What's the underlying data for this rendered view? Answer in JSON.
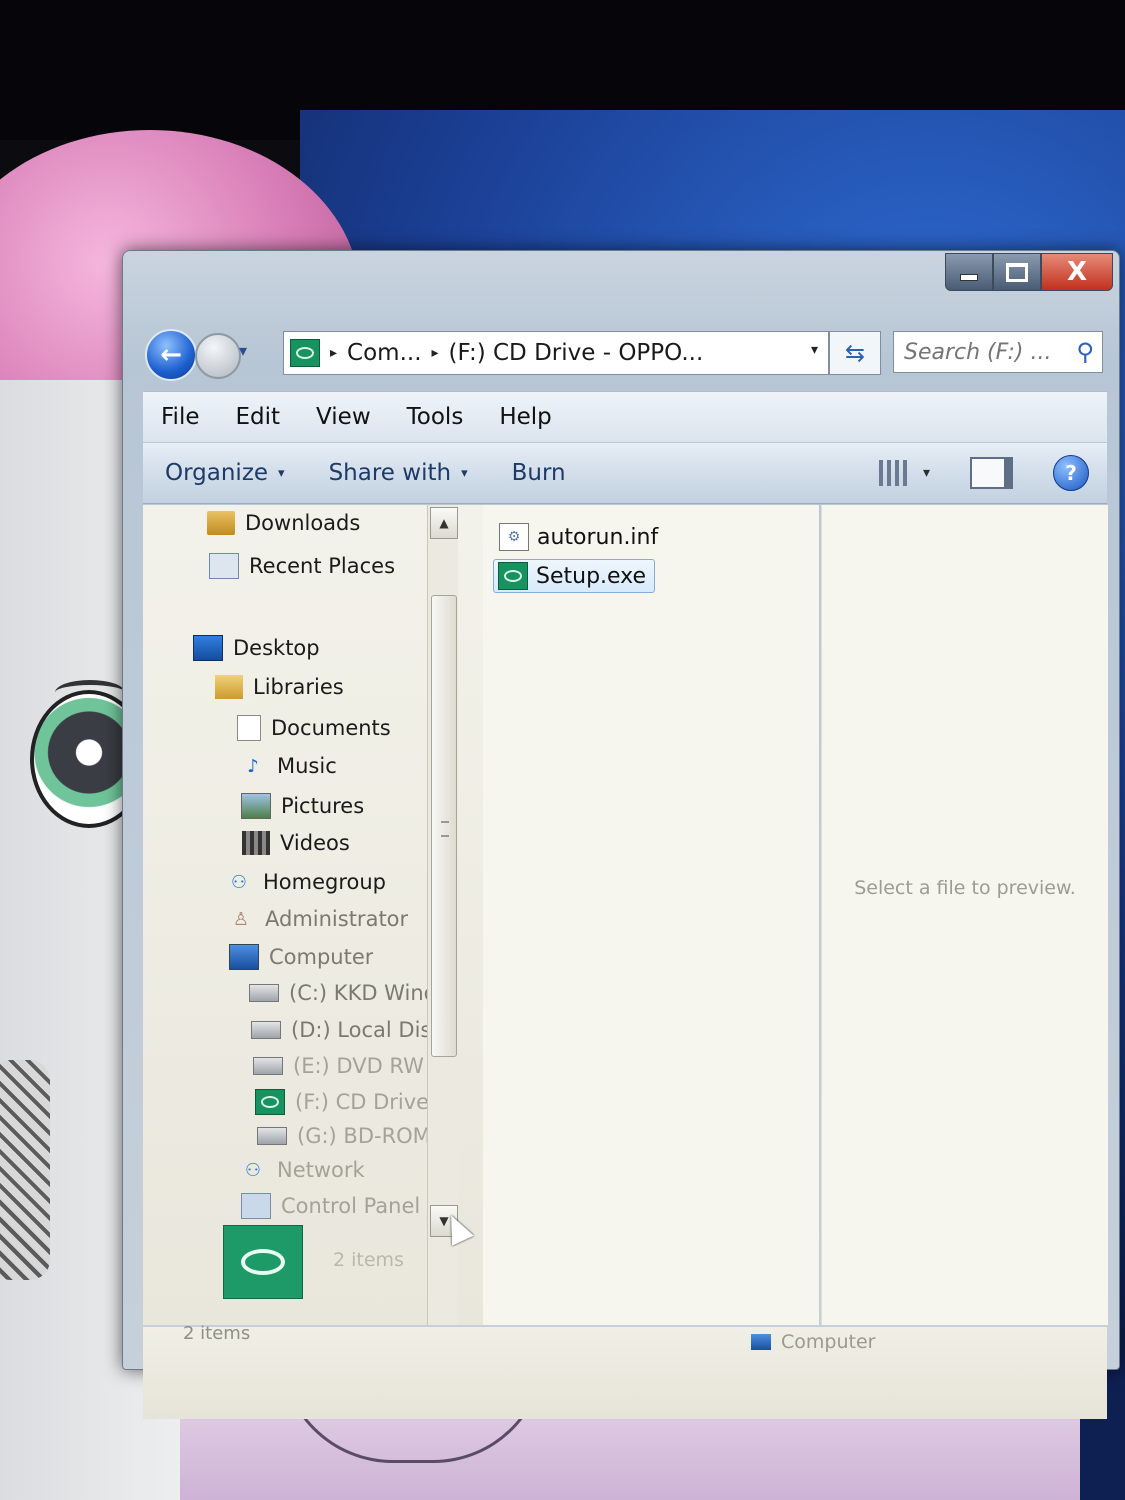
{
  "window": {
    "close_glyph": "X"
  },
  "navigation": {
    "back_glyph": "←",
    "recent_glyph": "▾",
    "breadcrumb": [
      {
        "label": "Com..."
      },
      {
        "label": "(F:) CD Drive - OPPO..."
      }
    ],
    "address_arrow": "▸",
    "address_dropdown_glyph": "▾",
    "refresh_glyph": "⇆",
    "search_placeholder": "Search (F:) ...",
    "search_glyph": "⚲"
  },
  "menubar": {
    "items": [
      "File",
      "Edit",
      "View",
      "Tools",
      "Help"
    ]
  },
  "toolbar": {
    "organize": "Organize",
    "share_with": "Share with",
    "burn": "Burn",
    "caret": "▾",
    "help_glyph": "?"
  },
  "nav_pane": {
    "items": [
      {
        "label": "Downloads",
        "icon": "downloads-icon"
      },
      {
        "label": "Recent Places",
        "icon": "recent-places-icon"
      },
      {
        "label": "Desktop",
        "icon": "desktop-icon"
      },
      {
        "label": "Libraries",
        "icon": "libraries-icon"
      },
      {
        "label": "Documents",
        "icon": "documents-icon"
      },
      {
        "label": "Music",
        "icon": "music-icon",
        "glyph": "♪"
      },
      {
        "label": "Pictures",
        "icon": "pictures-icon"
      },
      {
        "label": "Videos",
        "icon": "videos-icon"
      },
      {
        "label": "Homegroup",
        "icon": "homegroup-icon",
        "glyph": "⚇"
      },
      {
        "label": "Administrator",
        "icon": "user-icon",
        "glyph": "♙"
      },
      {
        "label": "Computer",
        "icon": "computer-icon"
      },
      {
        "label": "(C:) KKD Windc",
        "icon": "drive-icon"
      },
      {
        "label": "(D:) Local Disk",
        "icon": "drive-icon"
      },
      {
        "label": "(E:) DVD RW Dr",
        "icon": "dvd-drive-icon"
      },
      {
        "label": "(F:) CD Drive - (",
        "icon": "cd-drive-icon"
      },
      {
        "label": "(G:) BD-ROM D",
        "icon": "bd-drive-icon"
      },
      {
        "label": "Network",
        "icon": "network-icon",
        "glyph": "⚇"
      },
      {
        "label": "Control Panel",
        "icon": "control-panel-icon"
      }
    ],
    "scroll_up_glyph": "▲",
    "scroll_down_glyph": "▼"
  },
  "files": {
    "items": [
      {
        "name": "autorun.inf",
        "icon": "inf-file-icon",
        "glyph": "⚙",
        "selected": false
      },
      {
        "name": "Setup.exe",
        "icon": "exe-file-icon",
        "selected": true
      }
    ]
  },
  "preview": {
    "message": "Select a file to preview."
  },
  "details": {
    "count": "2 items"
  },
  "status": {
    "left": "2 items",
    "right": "Computer"
  },
  "colors": {
    "cd_green": "#17935f",
    "window_frame": "#b7c6d5",
    "toolbar_text": "#1e3a66",
    "pane_background": "#f7f6ee"
  }
}
